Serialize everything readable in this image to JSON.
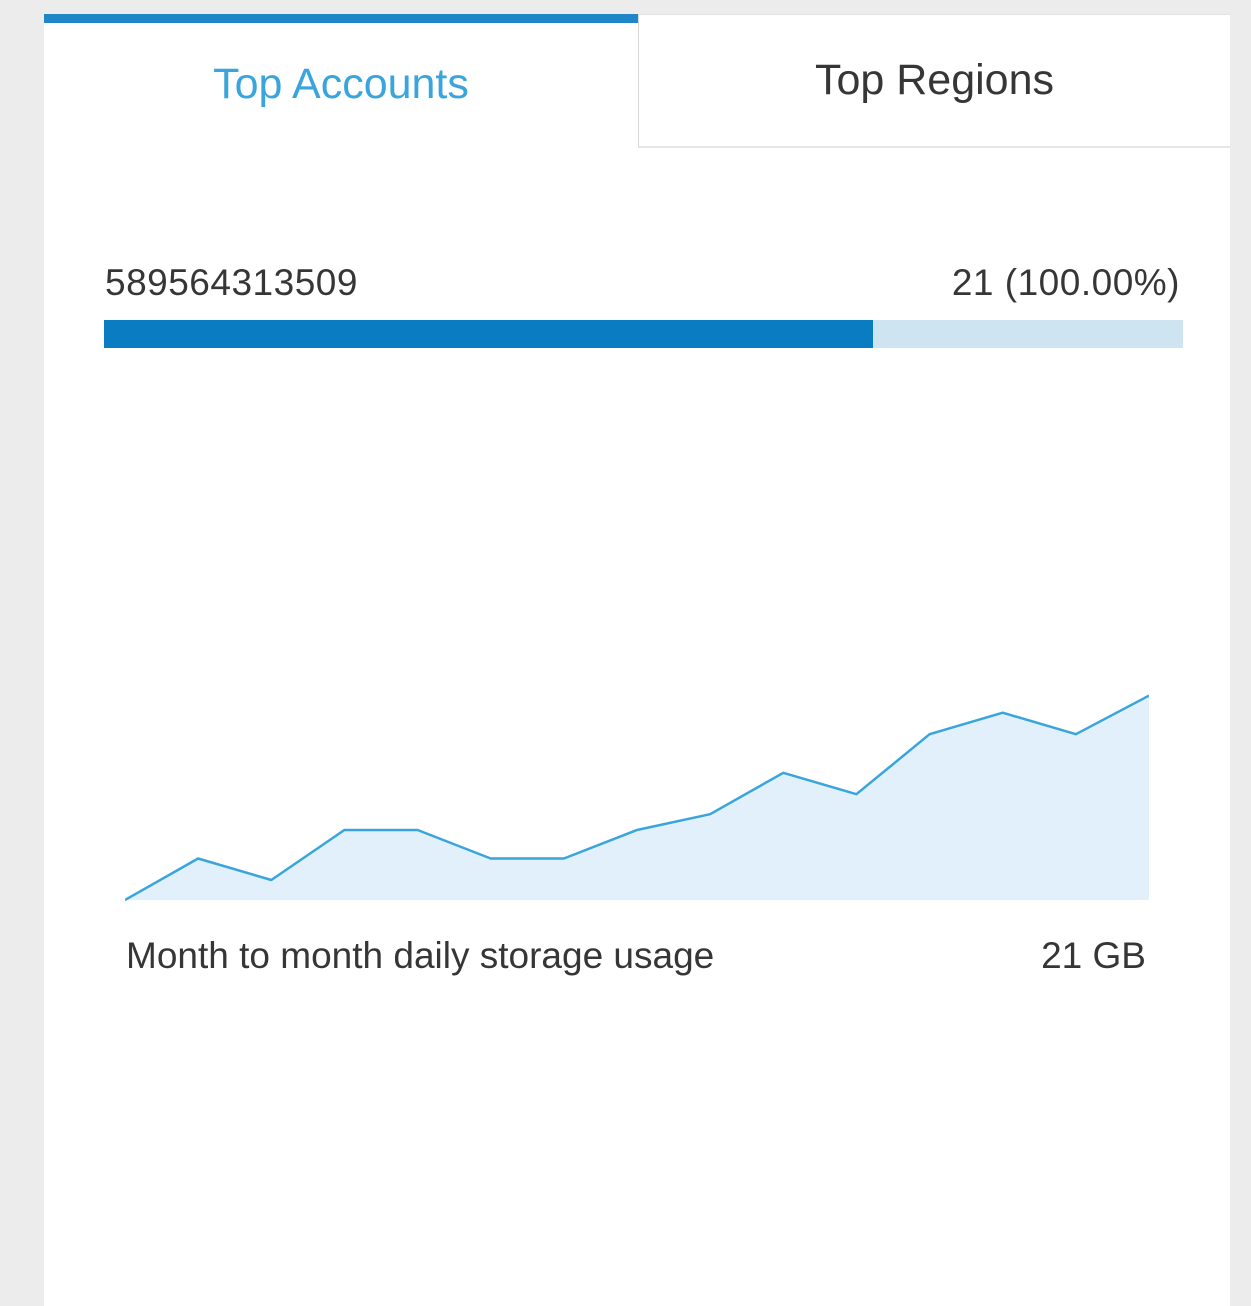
{
  "tabs": [
    {
      "label": "Top Accounts",
      "active": true
    },
    {
      "label": "Top Regions",
      "active": false
    }
  ],
  "account": {
    "id": "589564313509",
    "value_text": "21 (100.00%)",
    "bar_fill_percent": 71.3
  },
  "usage": {
    "caption": "Month to month daily storage usage",
    "total": "21 GB",
    "trend": [
      0,
      2.9,
      1.4,
      4.9,
      4.9,
      2.9,
      2.9,
      4.9,
      6.0,
      8.9,
      7.4,
      11.6,
      13.1,
      11.6,
      14.3
    ]
  },
  "colors": {
    "accent": "#1f86c8",
    "active_tab_text": "#39a5dc",
    "bar_fill": "#0a7cc1",
    "bar_track": "#cfe4f1",
    "line": "#39a5dc",
    "area": "#e1f0fa"
  }
}
